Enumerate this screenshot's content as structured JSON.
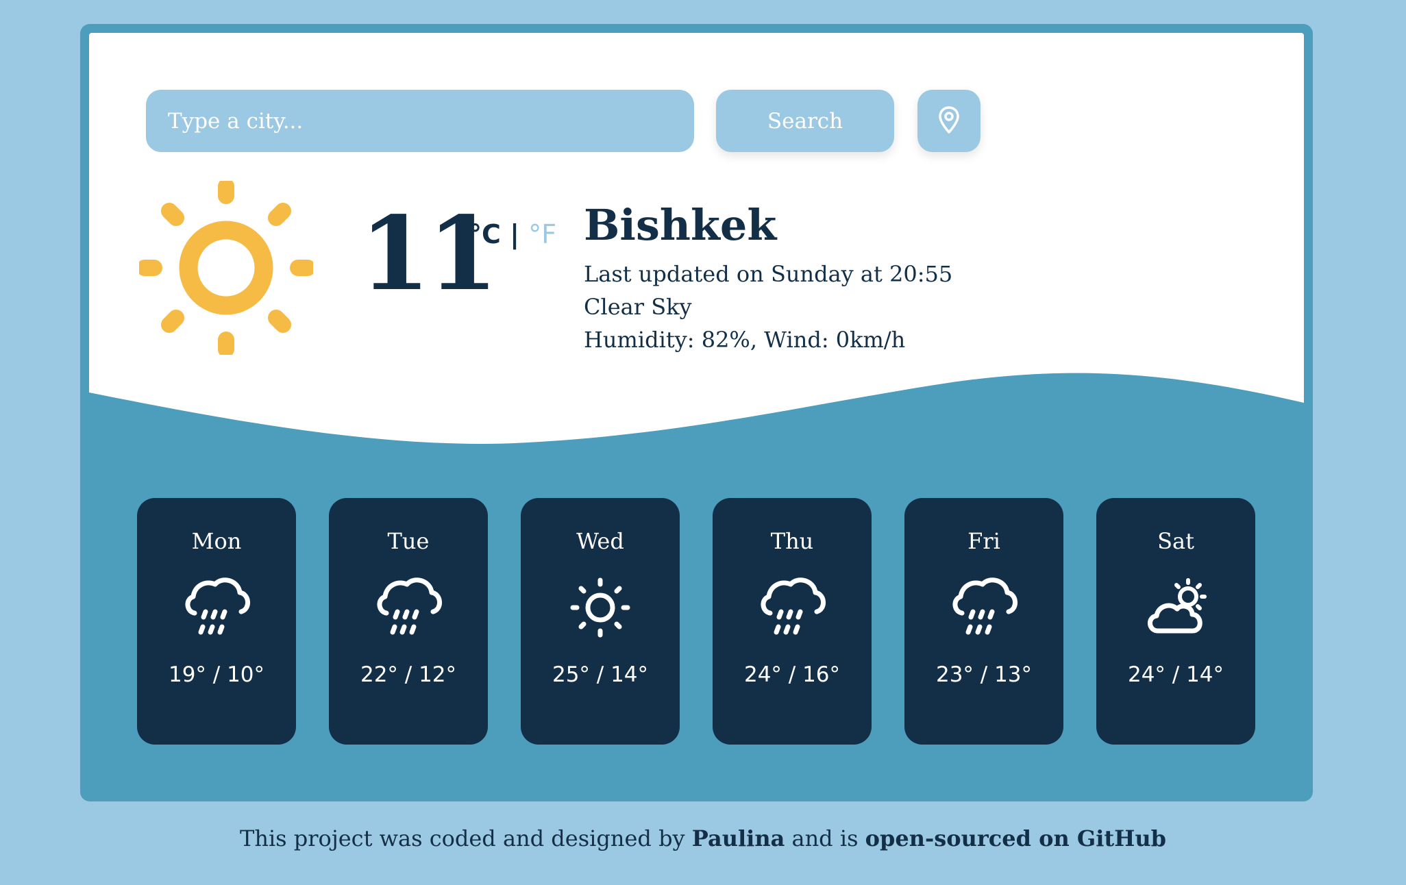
{
  "search": {
    "placeholder": "Type a city...",
    "button_label": "Search"
  },
  "current": {
    "temperature": "11",
    "unit_celsius": "°C",
    "unit_separator": "|",
    "unit_fahrenheit": "°F",
    "city": "Bishkek",
    "last_updated": "Last updated on Sunday at 20:55",
    "condition": "Clear Sky",
    "humidity_wind": "Humidity: 82%, Wind: 0km/h",
    "icon": "sun-icon"
  },
  "forecast": [
    {
      "day": "Mon",
      "icon": "rain-icon",
      "temps": "19° / 10°"
    },
    {
      "day": "Tue",
      "icon": "rain-icon",
      "temps": "22° / 12°"
    },
    {
      "day": "Wed",
      "icon": "sun-icon",
      "temps": "25° / 14°"
    },
    {
      "day": "Thu",
      "icon": "rain-icon",
      "temps": "24° / 16°"
    },
    {
      "day": "Fri",
      "icon": "rain-icon",
      "temps": "23° / 13°"
    },
    {
      "day": "Sat",
      "icon": "partly-cloudy-icon",
      "temps": "24° / 14°"
    }
  ],
  "footer": {
    "prefix": "This project was coded and designed by",
    "author": "Paulina",
    "middle": "and is",
    "link": "open-sourced on GitHub"
  },
  "colors": {
    "page_bg": "#9bc8e2",
    "card_bg": "#4d9dbd",
    "dark": "#132f47",
    "sun": "#f5bb45"
  }
}
